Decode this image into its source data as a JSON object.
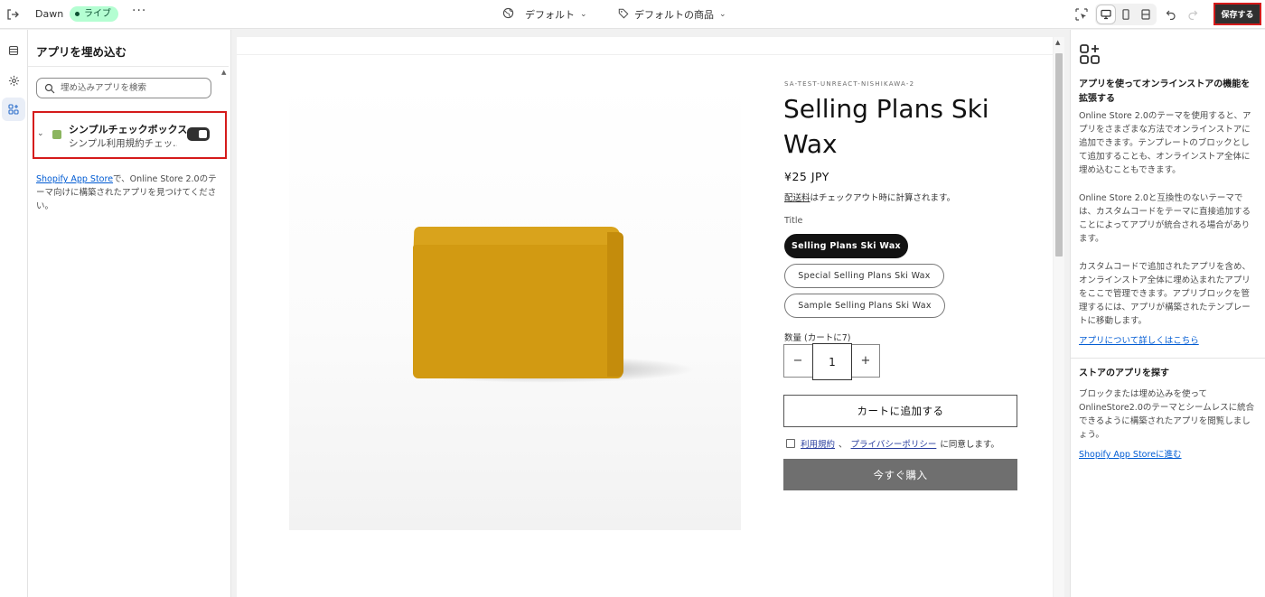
{
  "topbar": {
    "theme_name": "Dawn",
    "status_badge": "ライブ",
    "more_label": "···",
    "template_label": "デフォルト",
    "product_label": "デフォルトの商品",
    "save_label": "保存する"
  },
  "left_panel": {
    "title": "アプリを埋め込む",
    "search_placeholder": "埋め込みアプリを検索",
    "app": {
      "name": "シンプルチェックボックス",
      "description": "シンプル利用規約チェッ…",
      "enabled": true
    },
    "info_link": "Shopify App Store",
    "info_text": "で、Online Store 2.0のテーマ向けに構築されたアプリを見つけてください。"
  },
  "product": {
    "vendor": "SA-TEST-UNREACT-NISHIKAWA-2",
    "title": "Selling Plans Ski Wax",
    "price": "¥25 JPY",
    "shipping_link": "配送料",
    "shipping_text": "はチェックアウト時に計算されます。",
    "option_label": "Title",
    "options": [
      "Selling Plans Ski Wax",
      "Special Selling Plans Ski Wax",
      "Sample Selling Plans Ski Wax"
    ],
    "selected_option_index": 0,
    "quantity_label": "数量 (カートに7)",
    "quantity_minus": "−",
    "quantity_value": "1",
    "quantity_plus": "+",
    "add_to_cart": "カートに追加する",
    "terms_link1": "利用規約",
    "terms_sep": "、",
    "terms_link2": "プライバシーポリシー",
    "terms_suffix": "に同意します。",
    "buy_now": "今すぐ購入"
  },
  "right_panel": {
    "heading": "アプリを使ってオンラインストアの機能を拡張する",
    "para1": "Online Store 2.0のテーマを使用すると、アプリをさまざまな方法でオンラインストアに追加できます。テンプレートのブロックとして追加することも、オンラインストア全体に埋め込むこともできます。",
    "para2": "Online Store 2.0と互換性のないテーマでは、カスタムコードをテーマに直接追加することによってアプリが統合される場合があります。",
    "para3": "カスタムコードで追加されたアプリを含め、オンラインストア全体に埋め込まれたアプリをここで管理できます。アプリブロックを管理するには、アプリが構築されたテンプレートに移動します。",
    "link1": "アプリについて詳しくはこちら",
    "heading2": "ストアのアプリを探す",
    "para4": "ブロックまたは埋め込みを使ってOnlineStore2.0のテーマとシームレスに統合できるように構築されたアプリを閲覧しましょう。",
    "link2": "Shopify App Storeに進む"
  },
  "colors": {
    "save_border": "#d51b1b",
    "highlight_border": "#d51b1b",
    "link": "#005bd3",
    "buy_now_bg": "#6f6f6f",
    "wax": "#d29a12"
  },
  "icons": [
    "exit-icon",
    "globe-icon",
    "tag-icon",
    "chevron-down-icon",
    "select-element-icon",
    "desktop-icon",
    "mobile-icon",
    "fullscreen-icon",
    "undo-icon",
    "redo-icon",
    "sections-icon",
    "gear-icon",
    "apps-icon",
    "search-icon",
    "add-app-icon"
  ]
}
